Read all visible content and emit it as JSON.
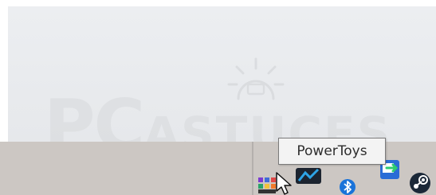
{
  "watermark": {
    "text_pc": "PC",
    "text_rest": "ASTUCES"
  },
  "taskbar": {
    "tray_icons": [
      {
        "name": "powertoys-icon"
      },
      {
        "name": "display-tool-icon"
      },
      {
        "name": "bluetooth-icon"
      },
      {
        "name": "remote-desktop-icon"
      },
      {
        "name": "steam-icon"
      }
    ]
  },
  "tooltip": {
    "text": "PowerToys"
  }
}
